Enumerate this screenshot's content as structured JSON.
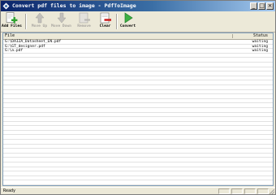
{
  "window": {
    "title": "Convert pdf files to image - PdfToImage",
    "minimize_glyph": "_",
    "maximize_glyph": "□",
    "close_glyph": "×"
  },
  "toolbar": {
    "buttons": [
      {
        "label": "Add Files",
        "icon": "add-files-icon",
        "enabled": true
      },
      {
        "label": "Move Up",
        "icon": "arrow-up-icon",
        "enabled": false
      },
      {
        "label": "Move Down",
        "icon": "arrow-down-icon",
        "enabled": false
      },
      {
        "label": "Remove",
        "icon": "remove-icon",
        "enabled": false
      },
      {
        "label": "Clear",
        "icon": "clear-icon",
        "enabled": true
      },
      {
        "label": "Convert",
        "icon": "play-icon",
        "enabled": true
      }
    ]
  },
  "list": {
    "columns": {
      "file": "File",
      "status": "Status"
    },
    "rows": [
      {
        "file": "G:\\DAIZA_Datasheet_EN.pdf",
        "status": "waiting"
      },
      {
        "file": "G:\\GT_designer.pdf",
        "status": "waiting"
      },
      {
        "file": "G:\\a.pdf",
        "status": "waiting"
      },
      {
        "file": "",
        "status": ""
      },
      {
        "file": "",
        "status": ""
      },
      {
        "file": "",
        "status": ""
      },
      {
        "file": "",
        "status": ""
      },
      {
        "file": "",
        "status": ""
      },
      {
        "file": "",
        "status": ""
      },
      {
        "file": "",
        "status": ""
      },
      {
        "file": "",
        "status": ""
      },
      {
        "file": "",
        "status": ""
      },
      {
        "file": "",
        "status": ""
      },
      {
        "file": "",
        "status": ""
      },
      {
        "file": "",
        "status": ""
      },
      {
        "file": "",
        "status": ""
      },
      {
        "file": "",
        "status": ""
      },
      {
        "file": "",
        "status": ""
      },
      {
        "file": "",
        "status": ""
      },
      {
        "file": "",
        "status": ""
      },
      {
        "file": "",
        "status": ""
      },
      {
        "file": "",
        "status": ""
      },
      {
        "file": "",
        "status": ""
      },
      {
        "file": "",
        "status": ""
      },
      {
        "file": "",
        "status": ""
      },
      {
        "file": "",
        "status": ""
      },
      {
        "file": "",
        "status": ""
      },
      {
        "file": "",
        "status": ""
      },
      {
        "file": "",
        "status": ""
      },
      {
        "file": "",
        "status": ""
      },
      {
        "file": "",
        "status": ""
      },
      {
        "file": "",
        "status": ""
      }
    ]
  },
  "statusbar": {
    "text": "Ready"
  },
  "colors": {
    "title_bar": "#0a246a",
    "window_face": "#ece9d8",
    "add_green": "#2fa12f",
    "clear_red": "#cc2222",
    "convert_green": "#3cb043"
  }
}
